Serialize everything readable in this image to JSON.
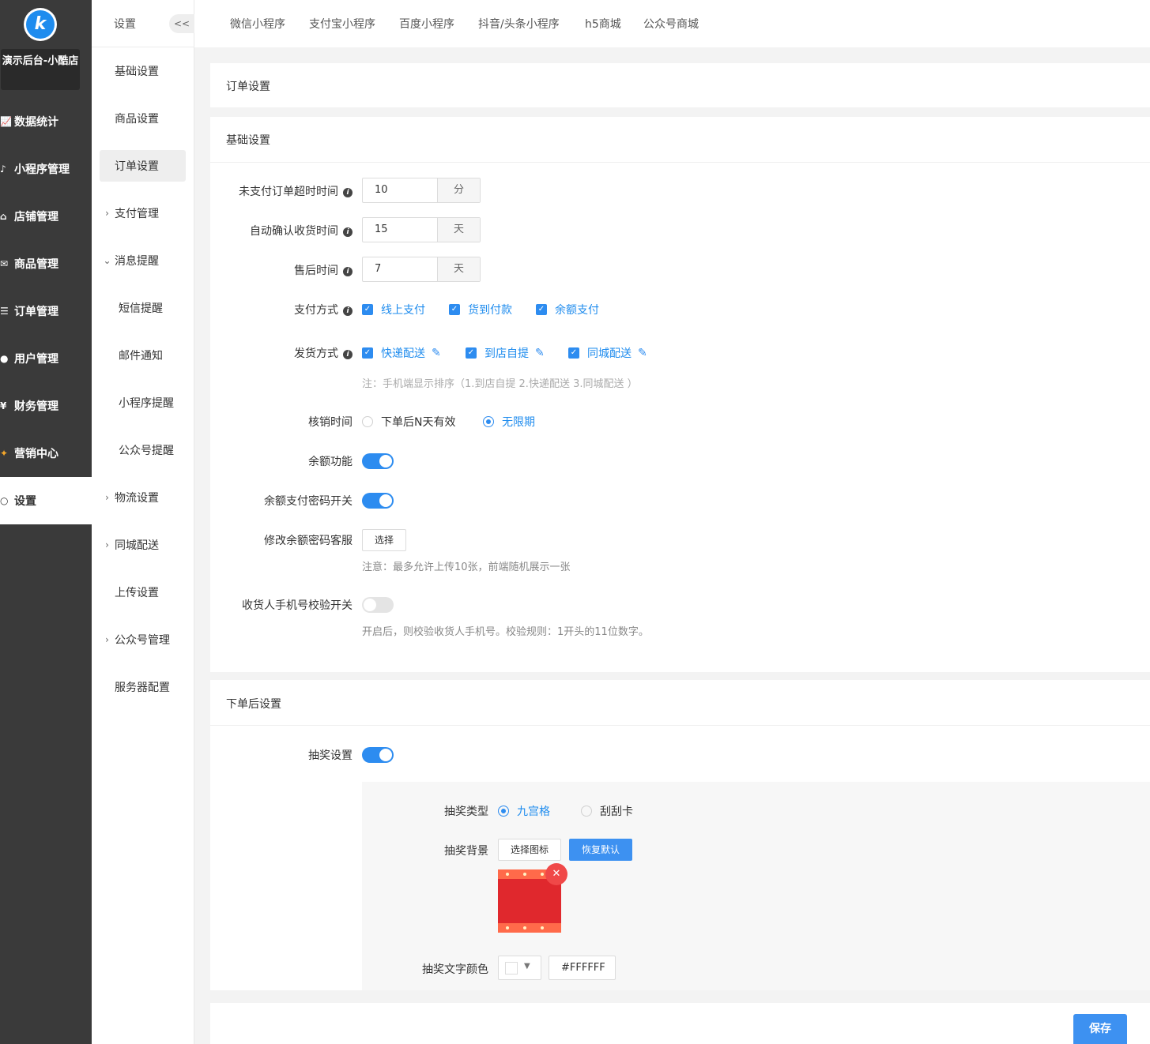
{
  "brand": {
    "logo_letter": "k",
    "shop_name": "演示后台-小酷店"
  },
  "sidebar": {
    "items": [
      {
        "label": "数据统计",
        "icon": "chart-icon"
      },
      {
        "label": "小程序管理",
        "icon": "miniprogram-icon"
      },
      {
        "label": "店铺管理",
        "icon": "store-icon"
      },
      {
        "label": "商品管理",
        "icon": "goods-icon"
      },
      {
        "label": "订单管理",
        "icon": "order-icon"
      },
      {
        "label": "用户管理",
        "icon": "user-icon"
      },
      {
        "label": "财务管理",
        "icon": "finance-icon"
      },
      {
        "label": "营销中心",
        "icon": "marketing-icon"
      },
      {
        "label": "设置",
        "icon": "settings-icon",
        "active": true
      }
    ]
  },
  "subnav": {
    "title": "设置",
    "collapse": "<<",
    "items": [
      {
        "label": "基础设置"
      },
      {
        "label": "商品设置"
      },
      {
        "label": "订单设置",
        "active": true
      },
      {
        "label": "支付管理",
        "expandable": true
      },
      {
        "label": "消息提醒",
        "expanded": true
      },
      {
        "label": "短信提醒",
        "child": true
      },
      {
        "label": "邮件通知",
        "child": true
      },
      {
        "label": "小程序提醒",
        "child": true
      },
      {
        "label": "公众号提醒",
        "child": true
      },
      {
        "label": "物流设置",
        "expandable": true
      },
      {
        "label": "同城配送",
        "expandable": true
      },
      {
        "label": "上传设置"
      },
      {
        "label": "公众号管理",
        "expandable": true
      },
      {
        "label": "服务器配置"
      }
    ]
  },
  "tabs": [
    "微信小程序",
    "支付宝小程序",
    "百度小程序",
    "抖音/头条小程序",
    "h5商城",
    "公众号商城"
  ],
  "page": {
    "title": "订单设置",
    "basic": {
      "title": "基础设置",
      "unpaid_timeout": {
        "label": "未支付订单超时时间",
        "value": "10",
        "unit": "分"
      },
      "auto_confirm": {
        "label": "自动确认收货时间",
        "value": "15",
        "unit": "天"
      },
      "after_sale": {
        "label": "售后时间",
        "value": "7",
        "unit": "天"
      },
      "payment": {
        "label": "支付方式",
        "options": [
          "线上支付",
          "货到付款",
          "余额支付"
        ]
      },
      "delivery": {
        "label": "发货方式",
        "options": [
          "快递配送",
          "到店自提",
          "同城配送"
        ],
        "note": "注：手机端显示排序（1.到店自提 2.快递配送 3.同城配送 ）"
      },
      "verify_time": {
        "label": "核销时间",
        "options": [
          "下单后N天有效",
          "无限期"
        ],
        "selected": "无限期"
      },
      "balance": {
        "label": "余额功能",
        "on": true
      },
      "balance_password": {
        "label": "余额支付密码开关",
        "on": true
      },
      "modify_password_service": {
        "label": "修改余额密码客服",
        "button": "选择",
        "note": "注意：最多允许上传10张，前端随机展示一张"
      },
      "phone_check": {
        "label": "收货人手机号校验开关",
        "on": false,
        "note": "开启后，则校验收货人手机号。校验规则：1开头的11位数字。"
      }
    },
    "after_order": {
      "title": "下单后设置",
      "lottery": {
        "label": "抽奖设置",
        "on": true
      },
      "lottery_type": {
        "label": "抽奖类型",
        "options": [
          "九宫格",
          "刮刮卡"
        ],
        "selected": "九宫格"
      },
      "lottery_bg": {
        "label": "抽奖背景",
        "choose_button": "选择图标",
        "reset_button": "恢复默认"
      },
      "lottery_text_color": {
        "label": "抽奖文字颜色",
        "value": "#FFFFFF"
      }
    },
    "save_button": "保存"
  },
  "colors": {
    "primary": "#2d8cf0",
    "sidebar_bg": "#3a3a3a",
    "lottery_red": "#e0282d"
  }
}
